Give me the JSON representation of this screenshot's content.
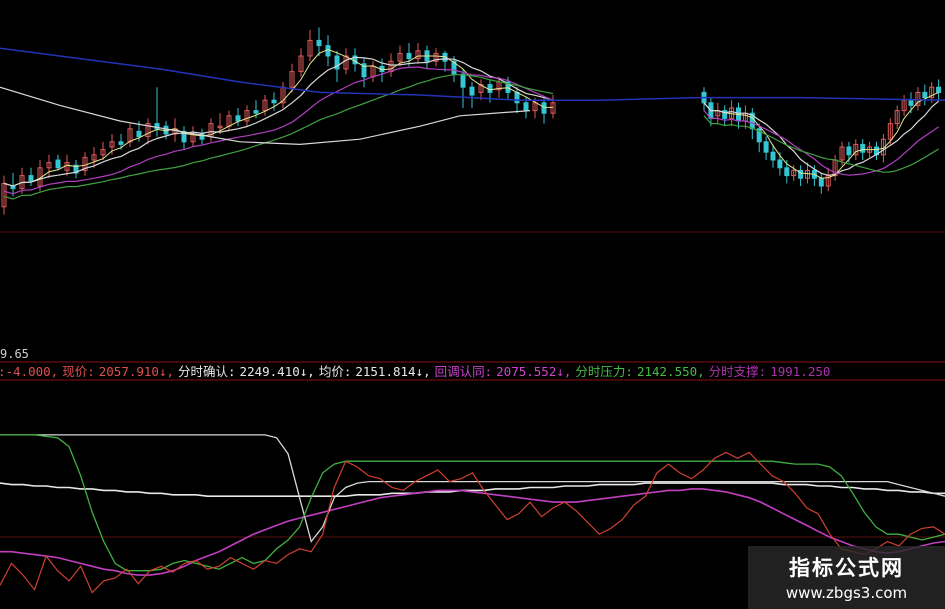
{
  "chart_data": [
    {
      "type": "candlestick",
      "title": "",
      "scale_label": "9.65",
      "up_color": "#e05a5a",
      "down_color": "#33c6d4",
      "overlay_colors": {
        "blue": "#2233b8",
        "white": "#d8d8d8",
        "purple": "#b040c0",
        "green": "#40a040",
        "yellow": "#e8e890"
      },
      "candles_segment_1": [
        [
          0.32,
          0.41,
          0.29,
          0.44
        ],
        [
          0.4,
          0.39,
          0.36,
          0.45
        ],
        [
          0.39,
          0.44,
          0.37,
          0.47
        ],
        [
          0.44,
          0.42,
          0.4,
          0.47
        ],
        [
          0.4,
          0.47,
          0.38,
          0.5
        ],
        [
          0.47,
          0.49,
          0.43,
          0.52
        ],
        [
          0.5,
          0.47,
          0.46,
          0.52
        ],
        [
          0.46,
          0.49,
          0.44,
          0.52
        ],
        [
          0.48,
          0.45,
          0.43,
          0.5
        ],
        [
          0.46,
          0.51,
          0.44,
          0.53
        ],
        [
          0.5,
          0.52,
          0.47,
          0.55
        ],
        [
          0.52,
          0.54,
          0.5,
          0.57
        ],
        [
          0.55,
          0.57,
          0.52,
          0.6
        ],
        [
          0.57,
          0.56,
          0.54,
          0.6
        ],
        [
          0.57,
          0.62,
          0.55,
          0.64
        ],
        [
          0.61,
          0.59,
          0.57,
          0.65
        ],
        [
          0.59,
          0.64,
          0.56,
          0.66
        ],
        [
          0.64,
          0.62,
          0.59,
          0.78
        ],
        [
          0.63,
          0.6,
          0.58,
          0.65
        ],
        [
          0.6,
          0.62,
          0.57,
          0.66
        ],
        [
          0.61,
          0.57,
          0.54,
          0.63
        ],
        [
          0.57,
          0.6,
          0.55,
          0.63
        ],
        [
          0.6,
          0.58,
          0.56,
          0.62
        ],
        [
          0.59,
          0.64,
          0.57,
          0.66
        ],
        [
          0.63,
          0.63,
          0.6,
          0.68
        ],
        [
          0.63,
          0.67,
          0.61,
          0.69
        ],
        [
          0.67,
          0.65,
          0.63,
          0.7
        ],
        [
          0.65,
          0.69,
          0.63,
          0.71
        ],
        [
          0.69,
          0.68,
          0.66,
          0.73
        ],
        [
          0.69,
          0.73,
          0.67,
          0.75
        ],
        [
          0.73,
          0.72,
          0.69,
          0.76
        ],
        [
          0.72,
          0.78,
          0.7,
          0.8
        ],
        [
          0.78,
          0.84,
          0.76,
          0.87
        ],
        [
          0.84,
          0.9,
          0.82,
          0.93
        ],
        [
          0.9,
          0.96,
          0.88,
          1.0
        ],
        [
          0.96,
          0.94,
          0.9,
          1.01
        ],
        [
          0.94,
          0.9,
          0.86,
          0.98
        ],
        [
          0.9,
          0.85,
          0.8,
          0.92
        ],
        [
          0.85,
          0.9,
          0.83,
          0.93
        ],
        [
          0.9,
          0.87,
          0.84,
          0.93
        ],
        [
          0.87,
          0.82,
          0.78,
          0.89
        ],
        [
          0.82,
          0.86,
          0.8,
          0.88
        ],
        [
          0.86,
          0.84,
          0.8,
          0.89
        ],
        [
          0.84,
          0.88,
          0.82,
          0.91
        ],
        [
          0.88,
          0.91,
          0.86,
          0.94
        ],
        [
          0.91,
          0.89,
          0.86,
          0.95
        ],
        [
          0.89,
          0.92,
          0.87,
          0.95
        ],
        [
          0.92,
          0.88,
          0.85,
          0.94
        ],
        [
          0.88,
          0.91,
          0.86,
          0.93
        ],
        [
          0.91,
          0.88,
          0.84,
          0.92
        ],
        [
          0.88,
          0.83,
          0.8,
          0.9
        ],
        [
          0.83,
          0.78,
          0.7,
          0.85
        ],
        [
          0.78,
          0.75,
          0.7,
          0.8
        ],
        [
          0.76,
          0.79,
          0.73,
          0.81
        ],
        [
          0.79,
          0.76,
          0.72,
          0.81
        ],
        [
          0.77,
          0.8,
          0.74,
          0.82
        ],
        [
          0.8,
          0.76,
          0.73,
          0.82
        ],
        [
          0.76,
          0.72,
          0.68,
          0.78
        ],
        [
          0.72,
          0.69,
          0.66,
          0.74
        ],
        [
          0.69,
          0.72,
          0.66,
          0.74
        ],
        [
          0.72,
          0.68,
          0.64,
          0.74
        ],
        [
          0.68,
          0.72,
          0.66,
          0.75
        ]
      ],
      "candles_segment_2": [
        [
          0.76,
          0.72,
          0.69,
          0.78
        ],
        [
          0.72,
          0.66,
          0.63,
          0.74
        ],
        [
          0.67,
          0.69,
          0.64,
          0.72
        ],
        [
          0.69,
          0.66,
          0.63,
          0.71
        ],
        [
          0.66,
          0.7,
          0.63,
          0.73
        ],
        [
          0.7,
          0.65,
          0.62,
          0.72
        ],
        [
          0.65,
          0.68,
          0.62,
          0.71
        ],
        [
          0.68,
          0.62,
          0.58,
          0.7
        ],
        [
          0.62,
          0.57,
          0.53,
          0.64
        ],
        [
          0.57,
          0.53,
          0.5,
          0.59
        ],
        [
          0.53,
          0.5,
          0.47,
          0.56
        ],
        [
          0.5,
          0.47,
          0.44,
          0.53
        ],
        [
          0.47,
          0.44,
          0.41,
          0.5
        ],
        [
          0.44,
          0.46,
          0.42,
          0.48
        ],
        [
          0.46,
          0.43,
          0.4,
          0.48
        ],
        [
          0.43,
          0.46,
          0.41,
          0.49
        ],
        [
          0.46,
          0.43,
          0.4,
          0.48
        ],
        [
          0.43,
          0.4,
          0.37,
          0.45
        ],
        [
          0.4,
          0.44,
          0.38,
          0.47
        ],
        [
          0.44,
          0.5,
          0.42,
          0.52
        ],
        [
          0.5,
          0.55,
          0.48,
          0.57
        ],
        [
          0.55,
          0.52,
          0.49,
          0.57
        ],
        [
          0.52,
          0.56,
          0.5,
          0.58
        ],
        [
          0.56,
          0.53,
          0.5,
          0.58
        ],
        [
          0.53,
          0.55,
          0.51,
          0.57
        ],
        [
          0.55,
          0.52,
          0.5,
          0.57
        ],
        [
          0.52,
          0.58,
          0.49,
          0.6
        ],
        [
          0.58,
          0.64,
          0.56,
          0.66
        ],
        [
          0.64,
          0.69,
          0.62,
          0.71
        ],
        [
          0.69,
          0.73,
          0.67,
          0.75
        ],
        [
          0.73,
          0.71,
          0.68,
          0.76
        ],
        [
          0.71,
          0.76,
          0.69,
          0.78
        ],
        [
          0.76,
          0.74,
          0.71,
          0.79
        ],
        [
          0.74,
          0.78,
          0.72,
          0.8
        ],
        [
          0.78,
          0.76,
          0.73,
          0.81
        ]
      ],
      "stats_line": [
        {
          "label": ":-4.000,",
          "color": "#e05050"
        },
        {
          "label": "现价:",
          "color": "#e05050"
        },
        {
          "label": "2057.910↓,",
          "color": "#e05050"
        },
        {
          "label": "分时确认:",
          "color": "#e8e8e8"
        },
        {
          "label": "2249.410↓,",
          "color": "#e8e8e8"
        },
        {
          "label": "均价:",
          "color": "#e8e8e8"
        },
        {
          "label": "2151.814↓,",
          "color": "#e8e8e8"
        },
        {
          "label": "回调认同:",
          "color": "#cc44cc"
        },
        {
          "label": "2075.552↓,",
          "color": "#cc44cc"
        },
        {
          "label": "分时压力:",
          "color": "#44bb44"
        },
        {
          "label": "2142.550,",
          "color": "#44bb44"
        },
        {
          "label": "分时支撑:",
          "color": "#aa33aa"
        },
        {
          "label": "1991.250",
          "color": "#aa33aa"
        }
      ]
    },
    {
      "type": "line",
      "series_colors": [
        "#d8d8d8",
        "#40b040",
        "#e8e8e8",
        "#c040c0",
        "#d04030"
      ],
      "levels": {
        "white_step": [
          0.98,
          0.98,
          0.98,
          0.98,
          0.98,
          0.98,
          0.98,
          0.98,
          0.98,
          0.98,
          0.98,
          0.98,
          0.98,
          0.98,
          0.98,
          0.98,
          0.98,
          0.98,
          0.98,
          0.98,
          0.98,
          0.98,
          0.98,
          0.98,
          0.96,
          0.85,
          0.55,
          0.25,
          0.35,
          0.55,
          0.62,
          0.65,
          0.66,
          0.66,
          0.66,
          0.66,
          0.66,
          0.66,
          0.66,
          0.66,
          0.66,
          0.66,
          0.66,
          0.66,
          0.66,
          0.66,
          0.66,
          0.66,
          0.66,
          0.66,
          0.66,
          0.66,
          0.66,
          0.66,
          0.66,
          0.66,
          0.66,
          0.66,
          0.66,
          0.66,
          0.66,
          0.66,
          0.66,
          0.66,
          0.66,
          0.66,
          0.66,
          0.66,
          0.66,
          0.66,
          0.66,
          0.66,
          0.66,
          0.66,
          0.66,
          0.66,
          0.66,
          0.66,
          0.64,
          0.62,
          0.6,
          0.58,
          0.56
        ],
        "green": [
          0.98,
          0.98,
          0.98,
          0.98,
          0.97,
          0.96,
          0.9,
          0.7,
          0.45,
          0.25,
          0.1,
          0.05,
          0.05,
          0.05,
          0.06,
          0.1,
          0.12,
          0.1,
          0.08,
          0.06,
          0.1,
          0.14,
          0.1,
          0.12,
          0.2,
          0.26,
          0.35,
          0.55,
          0.72,
          0.78,
          0.8,
          0.8,
          0.8,
          0.8,
          0.8,
          0.8,
          0.8,
          0.8,
          0.8,
          0.8,
          0.8,
          0.8,
          0.8,
          0.8,
          0.8,
          0.8,
          0.8,
          0.8,
          0.8,
          0.8,
          0.8,
          0.8,
          0.8,
          0.8,
          0.8,
          0.8,
          0.8,
          0.8,
          0.8,
          0.8,
          0.8,
          0.8,
          0.8,
          0.8,
          0.8,
          0.8,
          0.8,
          0.8,
          0.79,
          0.78,
          0.78,
          0.78,
          0.76,
          0.7,
          0.58,
          0.45,
          0.35,
          0.3,
          0.3,
          0.28,
          0.26,
          0.28,
          0.3
        ],
        "white_slow": [
          0.65,
          0.64,
          0.64,
          0.63,
          0.63,
          0.62,
          0.62,
          0.61,
          0.61,
          0.6,
          0.6,
          0.59,
          0.59,
          0.58,
          0.58,
          0.57,
          0.57,
          0.57,
          0.56,
          0.56,
          0.56,
          0.56,
          0.56,
          0.56,
          0.56,
          0.56,
          0.56,
          0.56,
          0.56,
          0.56,
          0.56,
          0.57,
          0.57,
          0.57,
          0.58,
          0.58,
          0.58,
          0.59,
          0.59,
          0.59,
          0.6,
          0.6,
          0.6,
          0.61,
          0.61,
          0.61,
          0.62,
          0.62,
          0.62,
          0.63,
          0.63,
          0.63,
          0.64,
          0.64,
          0.64,
          0.64,
          0.65,
          0.65,
          0.65,
          0.65,
          0.65,
          0.65,
          0.65,
          0.65,
          0.65,
          0.65,
          0.65,
          0.65,
          0.64,
          0.64,
          0.64,
          0.63,
          0.63,
          0.62,
          0.62,
          0.61,
          0.61,
          0.6,
          0.6,
          0.59,
          0.59,
          0.58,
          0.58
        ],
        "purple": [
          0.18,
          0.18,
          0.17,
          0.16,
          0.15,
          0.14,
          0.12,
          0.1,
          0.08,
          0.06,
          0.05,
          0.03,
          0.02,
          0.02,
          0.03,
          0.05,
          0.08,
          0.12,
          0.15,
          0.18,
          0.22,
          0.26,
          0.3,
          0.33,
          0.36,
          0.39,
          0.41,
          0.43,
          0.45,
          0.47,
          0.49,
          0.51,
          0.53,
          0.55,
          0.56,
          0.57,
          0.58,
          0.59,
          0.6,
          0.6,
          0.6,
          0.59,
          0.58,
          0.57,
          0.56,
          0.55,
          0.54,
          0.53,
          0.52,
          0.52,
          0.52,
          0.53,
          0.54,
          0.55,
          0.56,
          0.57,
          0.58,
          0.59,
          0.6,
          0.6,
          0.61,
          0.61,
          0.6,
          0.59,
          0.57,
          0.55,
          0.52,
          0.48,
          0.44,
          0.4,
          0.36,
          0.32,
          0.28,
          0.25,
          0.22,
          0.2,
          0.18,
          0.17,
          0.18,
          0.2,
          0.22,
          0.24,
          0.25
        ],
        "red": [
          -0.05,
          0.1,
          0.02,
          -0.08,
          0.15,
          0.05,
          -0.02,
          0.08,
          -0.1,
          -0.02,
          0.0,
          0.06,
          -0.04,
          0.05,
          0.08,
          0.04,
          0.1,
          0.12,
          0.06,
          0.08,
          0.14,
          0.1,
          0.06,
          0.12,
          0.1,
          0.16,
          0.2,
          0.18,
          0.3,
          0.62,
          0.8,
          0.76,
          0.7,
          0.68,
          0.62,
          0.6,
          0.66,
          0.7,
          0.74,
          0.66,
          0.68,
          0.72,
          0.6,
          0.5,
          0.4,
          0.44,
          0.52,
          0.42,
          0.48,
          0.52,
          0.46,
          0.38,
          0.3,
          0.34,
          0.4,
          0.5,
          0.56,
          0.72,
          0.78,
          0.72,
          0.68,
          0.74,
          0.82,
          0.86,
          0.82,
          0.86,
          0.78,
          0.7,
          0.66,
          0.58,
          0.48,
          0.44,
          0.3,
          0.2,
          0.18,
          0.16,
          0.2,
          0.25,
          0.22,
          0.3,
          0.34,
          0.35,
          0.3
        ]
      }
    }
  ],
  "watermark": {
    "title": "指标公式网",
    "url": "www.zbgs3.com"
  }
}
